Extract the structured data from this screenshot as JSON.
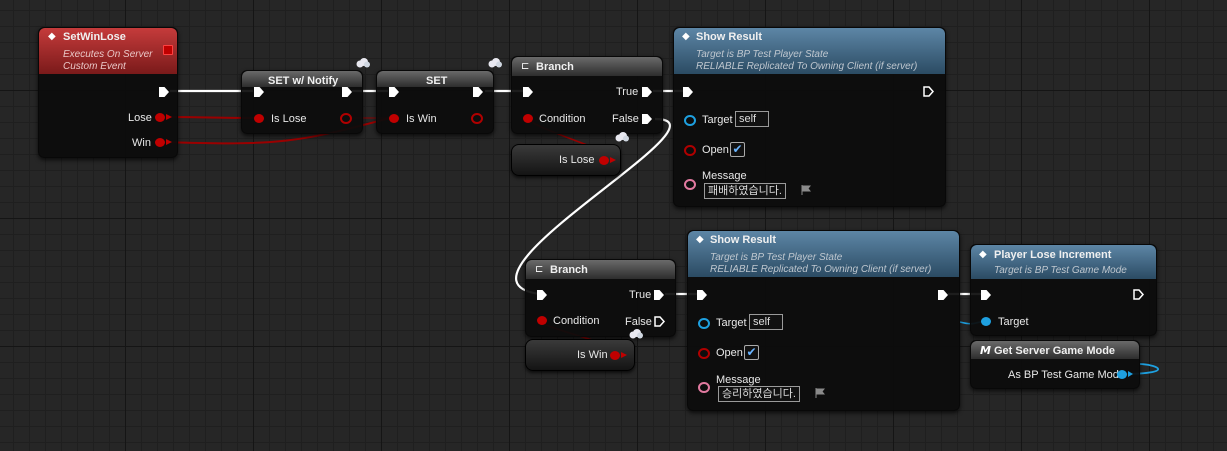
{
  "colors": {
    "event_header": "#a02626",
    "function_header": "#44698a",
    "exec_wire": "#ffffff",
    "bool_wire": "#9a0000",
    "object_wire": "#1ea0e0",
    "pure_header": "#555555"
  },
  "nodes": {
    "event": {
      "title": "SetWinLose",
      "line1": "Executes On Server",
      "line2": "Custom Event",
      "pin_lose": "Lose",
      "pin_win": "Win"
    },
    "set_notify": {
      "title": "SET w/ Notify",
      "pin": "Is Lose"
    },
    "set": {
      "title": "SET",
      "pin": "Is Win"
    },
    "branch1": {
      "title": "Branch",
      "condition": "Condition",
      "true": "True",
      "false": "False"
    },
    "branch2": {
      "title": "Branch",
      "condition": "Condition",
      "true": "True",
      "false": "False"
    },
    "get_is_lose": {
      "label": "Is Lose"
    },
    "get_is_win": {
      "label": "Is Win"
    },
    "show_result1": {
      "title": "Show Result",
      "line1": "Target is BP Test Player State",
      "line2": "RELIABLE Replicated To Owning Client (if server)",
      "target": "Target",
      "target_value": "self",
      "open": "Open",
      "open_checked": true,
      "message": "Message",
      "message_value": "패배하였습니다."
    },
    "show_result2": {
      "title": "Show Result",
      "line1": "Target is BP Test Player State",
      "line2": "RELIABLE Replicated To Owning Client (if server)",
      "target": "Target",
      "target_value": "self",
      "open": "Open",
      "open_checked": true,
      "message": "Message",
      "message_value": "승리하였습니다."
    },
    "player_lose": {
      "title": "Player Lose Increment",
      "line1": "Target is BP Test Game Mode",
      "target": "Target"
    },
    "get_game_mode": {
      "title": "Get Server Game Mode",
      "output": "As BP Test Game Mode"
    }
  }
}
